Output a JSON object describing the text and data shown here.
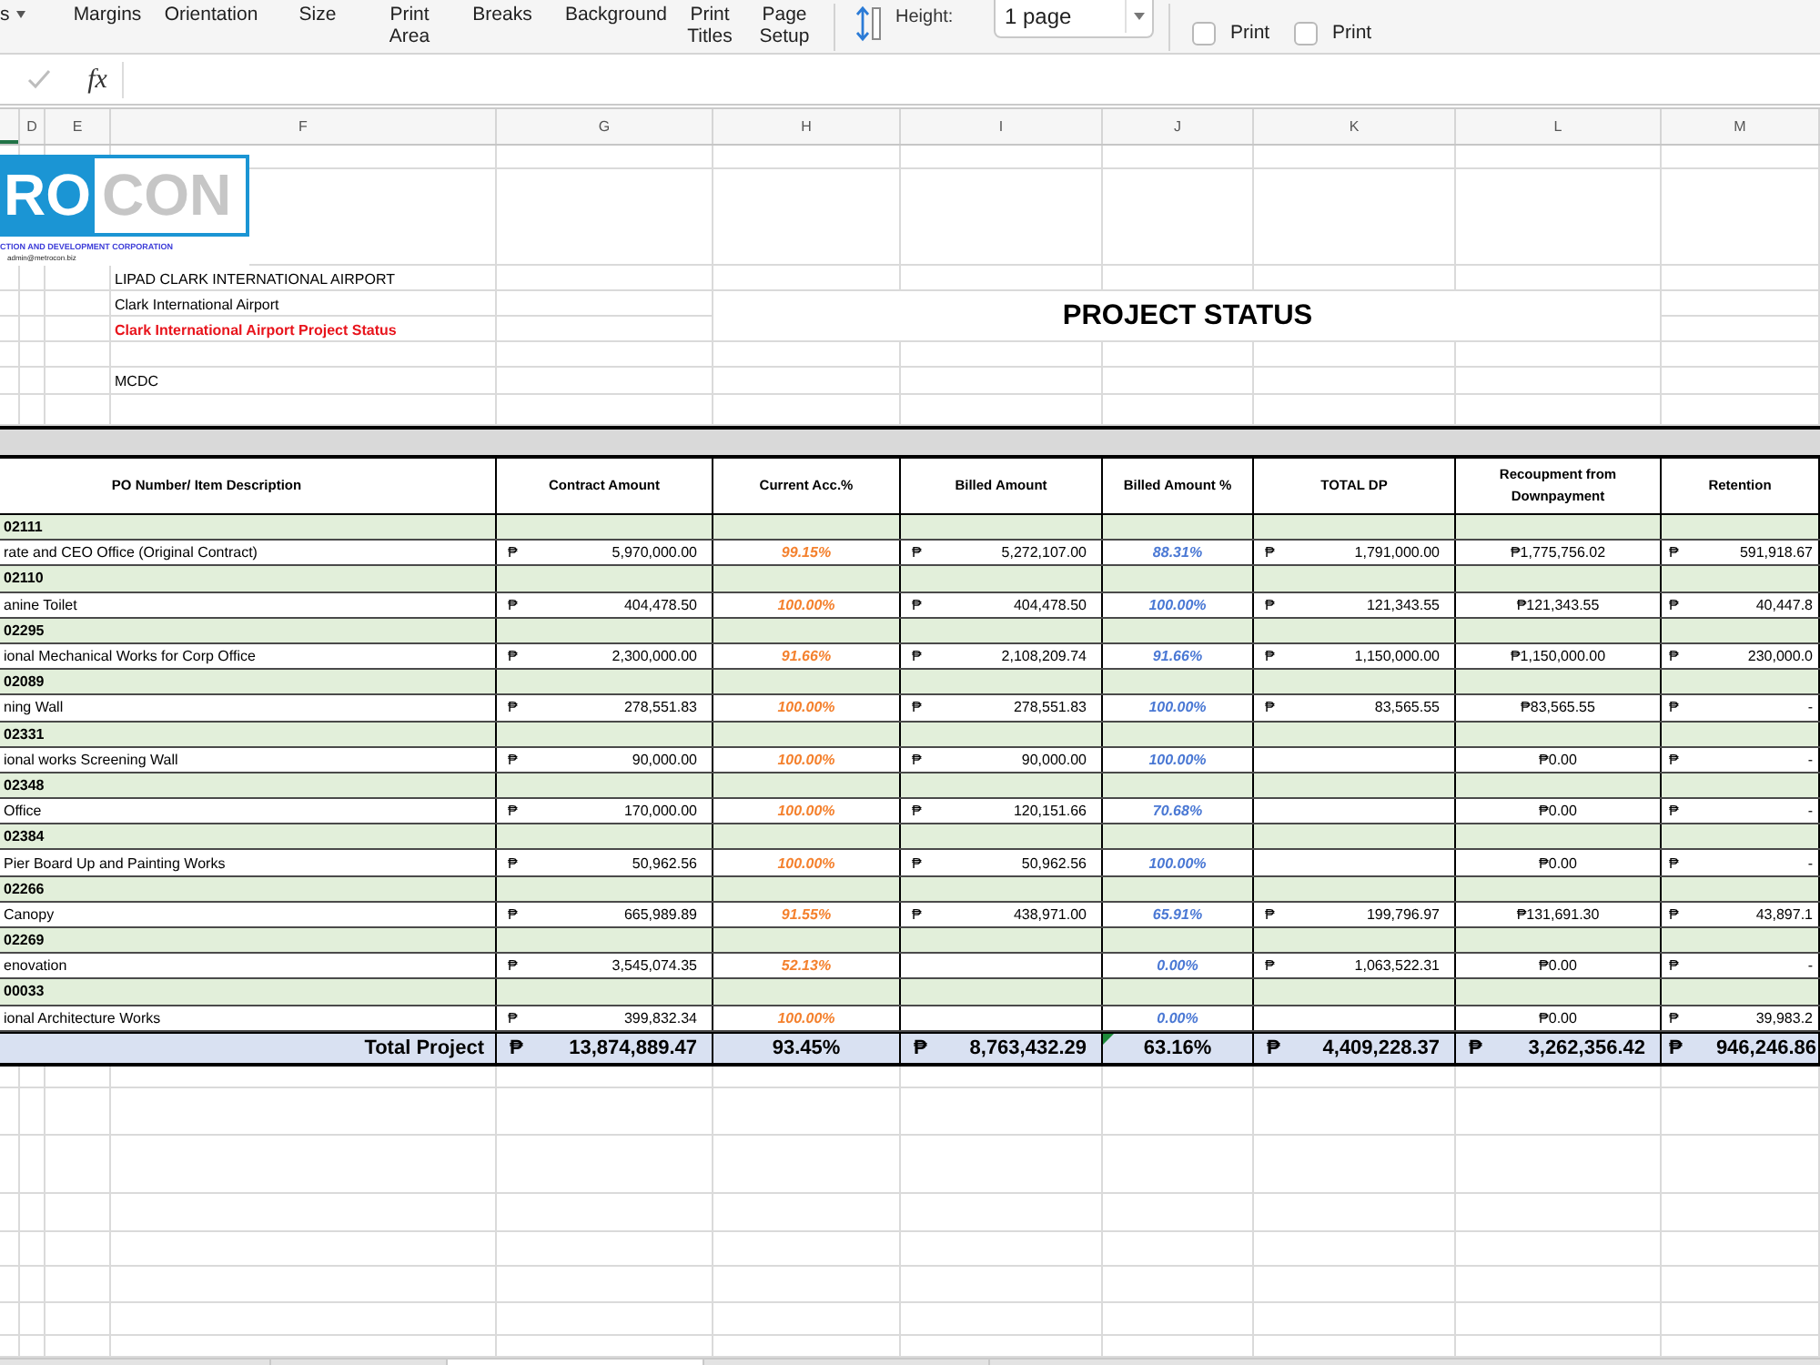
{
  "ribbon": {
    "cut_label": "s",
    "buttons": [
      "Margins",
      "Orientation",
      "Size",
      "Print Area",
      "Breaks",
      "Background",
      "Print Titles",
      "Page Setup"
    ],
    "height_label": "Height:",
    "height_value": "1 page",
    "checkboxes": [
      {
        "label": "Print",
        "checked": false
      },
      {
        "label": "Print",
        "checked": false
      }
    ]
  },
  "formula_bar": {
    "function_label": "fx"
  },
  "column_headers": {
    "partial_column": {
      "selected": true
    },
    "labels": [
      "D",
      "E",
      "F",
      "G",
      "H",
      "I",
      "J",
      "K",
      "L",
      "M"
    ]
  },
  "sheet": {
    "logo": {
      "wordmark": [
        "RO",
        "CON"
      ],
      "tagline": "CTION AND DEVELOPMENT CORPORATION",
      "email": "admin@metrocon.biz"
    },
    "info_lines": [
      {
        "text": "LIPAD CLARK INTERNATIONAL AIRPORT",
        "kind": "plain"
      },
      {
        "text": "Clark International Airport",
        "kind": "plain"
      },
      {
        "text": "Clark International Airport Project Status",
        "kind": "emphasis"
      },
      {
        "text": "MCDC",
        "kind": "plain"
      }
    ],
    "title": "PROJECT STATUS",
    "table": {
      "columns": [
        "PO Number/ Item Description",
        "Contract Amount",
        "Current Acc.%",
        "Billed Amount",
        "Billed Amount %",
        "TOTAL DP",
        "Recoupment from Downpayment",
        "Retention"
      ],
      "rows": [
        {
          "po_number": "02111",
          "description": "rate and CEO Office (Original Contract)",
          "contract": {
            "currency": "₱",
            "amount": "5,970,000.00"
          },
          "current_acc": "99.15%",
          "billed": {
            "currency": "₱",
            "amount": "5,272,107.00"
          },
          "billed_pct": "88.31%",
          "total_dp": {
            "currency": "₱",
            "amount": "1,791,000.00"
          },
          "recoupment": "₱1,775,756.02",
          "retention": {
            "currency": "₱",
            "amount": "591,918.67"
          }
        },
        {
          "po_number": "02110",
          "description": "anine Toilet",
          "contract": {
            "currency": "₱",
            "amount": "404,478.50"
          },
          "current_acc": "100.00%",
          "billed": {
            "currency": "₱",
            "amount": "404,478.50"
          },
          "billed_pct": "100.00%",
          "total_dp": {
            "currency": "₱",
            "amount": "121,343.55"
          },
          "recoupment": "₱121,343.55",
          "retention": {
            "currency": "₱",
            "amount": "40,447.8"
          }
        },
        {
          "po_number": "02295",
          "description": "ional Mechanical Works for Corp Office",
          "contract": {
            "currency": "₱",
            "amount": "2,300,000.00"
          },
          "current_acc": "91.66%",
          "billed": {
            "currency": "₱",
            "amount": "2,108,209.74"
          },
          "billed_pct": "91.66%",
          "total_dp": {
            "currency": "₱",
            "amount": "1,150,000.00"
          },
          "recoupment": "₱1,150,000.00",
          "retention": {
            "currency": "₱",
            "amount": "230,000.0"
          }
        },
        {
          "po_number": "02089",
          "description": "ning Wall",
          "contract": {
            "currency": "₱",
            "amount": "278,551.83"
          },
          "current_acc": "100.00%",
          "billed": {
            "currency": "₱",
            "amount": "278,551.83"
          },
          "billed_pct": "100.00%",
          "total_dp": {
            "currency": "₱",
            "amount": "83,565.55"
          },
          "recoupment": "₱83,565.55",
          "retention": {
            "currency": "₱",
            "amount": "-"
          }
        },
        {
          "po_number": "02331",
          "description": "ional works Screening Wall",
          "contract": {
            "currency": "₱",
            "amount": "90,000.00"
          },
          "current_acc": "100.00%",
          "billed": {
            "currency": "₱",
            "amount": "90,000.00"
          },
          "billed_pct": "100.00%",
          "recoupment": "₱0.00",
          "retention": {
            "currency": "₱",
            "amount": "-"
          }
        },
        {
          "po_number": "02348",
          "description": "Office",
          "contract": {
            "currency": "₱",
            "amount": "170,000.00"
          },
          "current_acc": "100.00%",
          "billed": {
            "currency": "₱",
            "amount": "120,151.66"
          },
          "billed_pct": "70.68%",
          "recoupment": "₱0.00",
          "retention": {
            "currency": "₱",
            "amount": "-"
          }
        },
        {
          "po_number": "02384",
          "description": "Pier Board Up and Painting Works",
          "contract": {
            "currency": "₱",
            "amount": "50,962.56"
          },
          "current_acc": "100.00%",
          "billed": {
            "currency": "₱",
            "amount": "50,962.56"
          },
          "billed_pct": "100.00%",
          "recoupment": "₱0.00",
          "retention": {
            "currency": "₱",
            "amount": "-"
          }
        },
        {
          "po_number": "02266",
          "description": "Canopy",
          "contract": {
            "currency": "₱",
            "amount": "665,989.89"
          },
          "current_acc": "91.55%",
          "billed": {
            "currency": "₱",
            "amount": "438,971.00"
          },
          "billed_pct": "65.91%",
          "total_dp": {
            "currency": "₱",
            "amount": "199,796.97"
          },
          "recoupment": "₱131,691.30",
          "retention": {
            "currency": "₱",
            "amount": "43,897.1"
          }
        },
        {
          "po_number": "02269",
          "description": "enovation",
          "contract": {
            "currency": "₱",
            "amount": "3,545,074.35"
          },
          "current_acc": "52.13%",
          "billed_pct": "0.00%",
          "total_dp": {
            "currency": "₱",
            "amount": "1,063,522.31"
          },
          "recoupment": "₱0.00",
          "retention": {
            "currency": "₱",
            "amount": "-"
          }
        },
        {
          "po_number": "00033",
          "description": "ional Architecture Works",
          "contract": {
            "currency": "₱",
            "amount": "399,832.34"
          },
          "current_acc": "100.00%",
          "billed_pct": "0.00%",
          "recoupment": "₱0.00",
          "retention": {
            "currency": "₱",
            "amount": "39,983.2"
          }
        }
      ],
      "total": {
        "label": "Total Project",
        "contract": {
          "currency": "₱",
          "amount": "13,874,889.47"
        },
        "current_acc": "93.45%",
        "billed": {
          "currency": "₱",
          "amount": "8,763,432.29"
        },
        "billed_pct": "63.16%",
        "billed_pct_flagged": true,
        "total_dp": {
          "currency": "₱",
          "amount": "4,409,228.37"
        },
        "recoupment": {
          "currency": "₱",
          "amount": "3,262,356.42"
        },
        "retention": {
          "currency": "₱",
          "amount": "946,246.86"
        }
      }
    }
  },
  "sheet_tabs": [
    {
      "selected": false
    },
    {
      "selected": false
    },
    {
      "selected": true
    },
    {
      "selected": false
    }
  ]
}
